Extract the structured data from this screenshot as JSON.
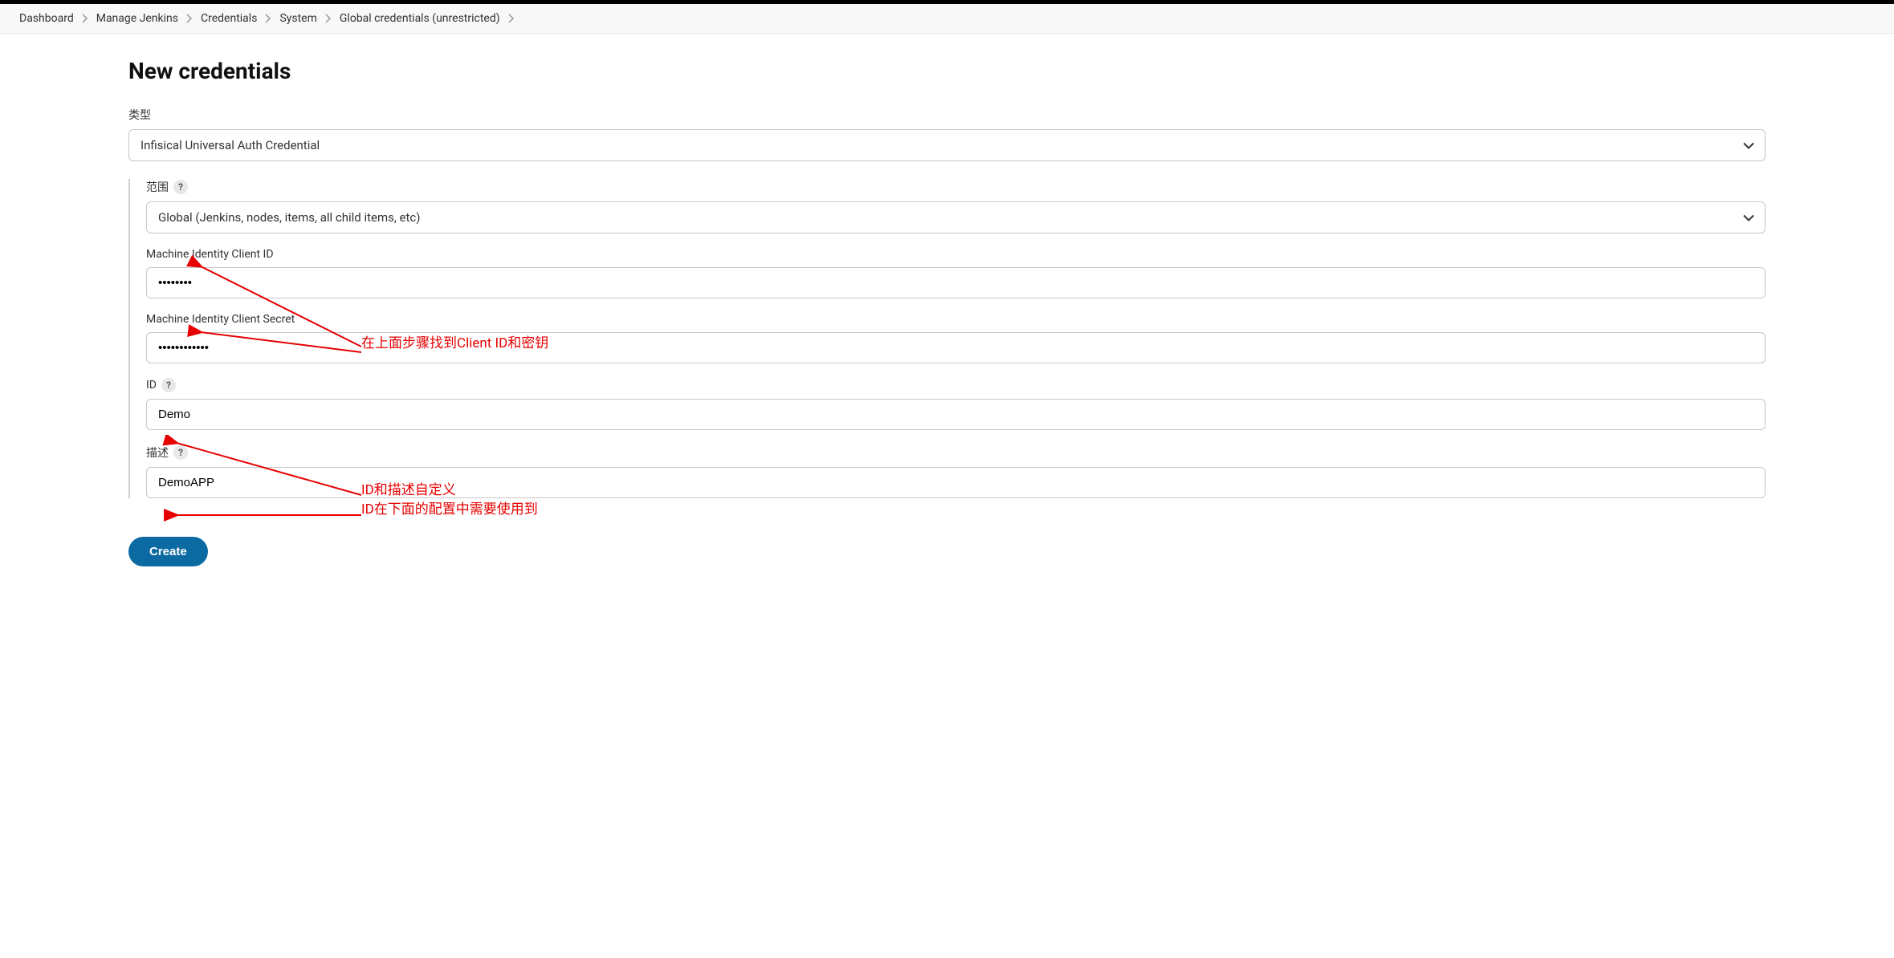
{
  "breadcrumb": {
    "items": [
      "Dashboard",
      "Manage Jenkins",
      "Credentials",
      "System",
      "Global credentials (unrestricted)"
    ]
  },
  "page": {
    "title": "New credentials"
  },
  "form": {
    "type_label": "类型",
    "type_value": "Infisical Universal Auth Credential",
    "scope_label": "范围",
    "scope_value": "Global (Jenkins, nodes, items, all child items, etc)",
    "client_id_label": "Machine Identity Client ID",
    "client_id_value": "••••••••",
    "client_secret_label": "Machine Identity Client Secret",
    "client_secret_value": "••••••••••••",
    "id_label": "ID",
    "id_value": "Demo",
    "description_label": "描述",
    "description_value": "DemoAPP",
    "create_button": "Create",
    "help_symbol": "?"
  },
  "annotations": {
    "note1": "在上面步骤找到Client ID和密钥",
    "note2_line1": "ID和描述自定义",
    "note2_line2": "ID在下面的配置中需要使用到"
  }
}
